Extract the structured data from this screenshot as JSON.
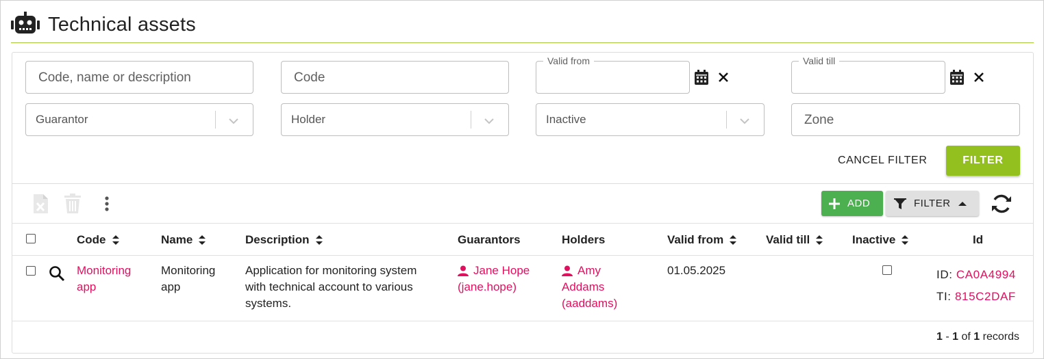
{
  "page": {
    "title": "Technical assets",
    "title_icon": "robot-icon"
  },
  "filters": {
    "search_placeholder": "Code, name or description",
    "code_placeholder": "Code",
    "valid_from_label": "Valid from",
    "valid_till_label": "Valid till",
    "guarantor_placeholder": "Guarantor",
    "holder_placeholder": "Holder",
    "inactive_placeholder": "Inactive",
    "zone_placeholder": "Zone",
    "cancel_label": "CANCEL FILTER",
    "filter_label": "FILTER"
  },
  "toolbar": {
    "add_label": "ADD",
    "filter_toggle_label": "FILTER"
  },
  "table": {
    "columns": [
      "Code",
      "Name",
      "Description",
      "Guarantors",
      "Holders",
      "Valid from",
      "Valid till",
      "Inactive",
      "Id"
    ],
    "rows": [
      {
        "code_line1": "Monitoring",
        "code_line2": "app",
        "name_line1": "Monitoring",
        "name_line2": "app",
        "description_line1": "Application for monitoring system",
        "description_line2": "with technical account to various",
        "description_line3": "systems.",
        "guarantor_line1": "Jane Hope",
        "guarantor_line2": "(jane.hope)",
        "holder_line1": "Amy",
        "holder_line2": "Addams",
        "holder_line3": "(aaddams)",
        "valid_from": "01.05.2025",
        "valid_till": "",
        "id_label": "ID:",
        "id_value": "CA0A4994",
        "ti_label": "TI:",
        "ti_value": "815C2DAF"
      }
    ]
  },
  "pagination": {
    "from": "1",
    "to": "1",
    "total": "1",
    "of_label": "of",
    "records_label": "records"
  },
  "colors": {
    "accent_green": "#93c01f",
    "add_green": "#4caf50",
    "link_pink": "#e0105f",
    "header_line": "#a6c93d"
  }
}
